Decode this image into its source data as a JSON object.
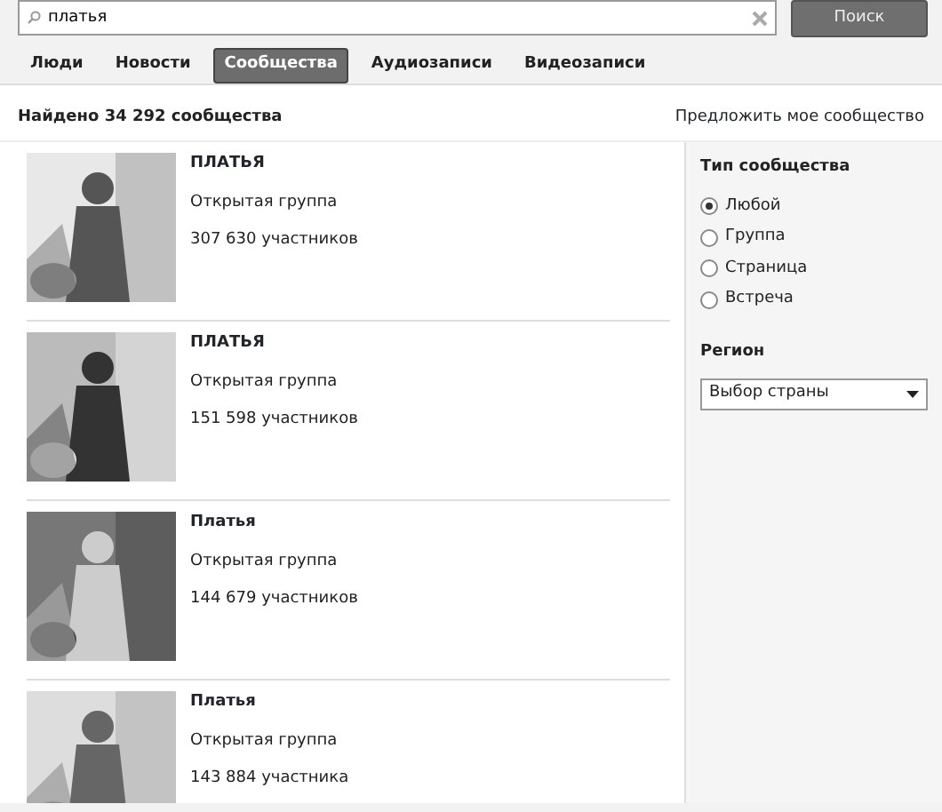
{
  "search": {
    "value": "платья",
    "button": "Поиск"
  },
  "tabs": [
    {
      "label": "Люди",
      "selected": false
    },
    {
      "label": "Новости",
      "selected": false
    },
    {
      "label": "Сообщества",
      "selected": true
    },
    {
      "label": "Аудиозаписи",
      "selected": false
    },
    {
      "label": "Видеозаписи",
      "selected": false
    }
  ],
  "summary": "Найдено 34 292 сообщества",
  "suggest_link": "Предложить мое сообщество",
  "results": [
    {
      "title": "ПЛАТЬЯ",
      "type": "Открытая группа",
      "members": "307 630 участников",
      "kind": "picture"
    },
    {
      "title": "ПЛАТЬЯ",
      "type": "Открытая группа",
      "members": "151 598 участников",
      "kind": "picture"
    },
    {
      "title": "Платья",
      "type": "Открытая группа",
      "members": "144 679 участников",
      "kind": "picture"
    },
    {
      "title": "Платья",
      "type": "Открытая группа",
      "members": "143 884 участника",
      "kind": "picture"
    }
  ],
  "filters": {
    "type_heading": "Тип сообщества",
    "options": [
      {
        "label": "Любой",
        "selected": true
      },
      {
        "label": "Группа",
        "selected": false
      },
      {
        "label": "Страница",
        "selected": false
      },
      {
        "label": "Встреча",
        "selected": false
      }
    ],
    "region_heading": "Регион",
    "region_select": "Выбор страны"
  }
}
